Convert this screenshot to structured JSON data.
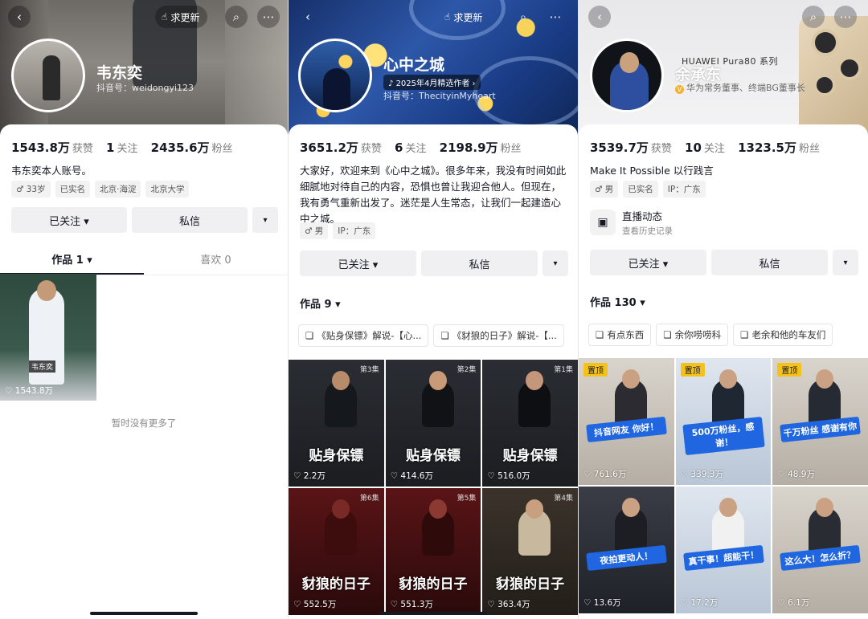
{
  "profiles": [
    {
      "update_label": "求更新",
      "name": "韦东奕",
      "douyin_id": "抖音号：weidongyi123",
      "stats": {
        "likes": "1543.8万",
        "likes_label": "获赞",
        "following": "1",
        "following_label": "关注",
        "fans": "2435.6万",
        "fans_label": "粉丝"
      },
      "bio": "韦东奕本人账号。",
      "tags": [
        "♂ 33岁",
        "已实名",
        "北京·海淀",
        "北京大学"
      ],
      "actions": {
        "follow": "已关注 ▾",
        "message": "私信",
        "more": "▾"
      },
      "tabs": [
        {
          "label": "作品 1 ▾"
        },
        {
          "label": "喜欢 0"
        }
      ],
      "works": [
        {
          "likes": "1543.8万",
          "label": "韦东奕"
        }
      ],
      "no_more": "暂时没有更多了"
    },
    {
      "update_label": "求更新",
      "name": "心中之城",
      "badge": "2025年4月精选作者 ›",
      "douyin_id": "抖音号：ThecityinMyheart",
      "stats": {
        "likes": "3651.2万",
        "likes_label": "获赞",
        "following": "6",
        "following_label": "关注",
        "fans": "2198.9万",
        "fans_label": "粉丝"
      },
      "bio": "大家好，欢迎来到《心中之城》。很多年来，我没有时间如此细腻地对待自己的内容，恐惧也曾让我迎合他人。但现在，我有勇气重新出发了。迷茫是人生常态，让我们一起建造心中之城。",
      "tags": [
        "♂ 男",
        "IP：广东"
      ],
      "actions": {
        "follow": "已关注 ▾",
        "message": "私信",
        "more": "▾"
      },
      "works_label": "作品 9 ▾",
      "chips": [
        "《贴身保镖》解说-【心...",
        "《豺狼的日子》解说-【..."
      ],
      "works": [
        {
          "caption": "贴身保镖",
          "ep": "第3集",
          "likes": "2.2万"
        },
        {
          "caption": "贴身保镖",
          "ep": "第2集",
          "likes": "414.6万"
        },
        {
          "caption": "贴身保镖",
          "ep": "第1集",
          "likes": "516.0万"
        },
        {
          "caption": "豺狼的日子",
          "ep": "第6集",
          "likes": "552.5万"
        },
        {
          "caption": "豺狼的日子",
          "ep": "第5集",
          "likes": "551.3万"
        },
        {
          "caption": "豺狼的日子",
          "ep": "第4集",
          "likes": "363.4万"
        }
      ]
    },
    {
      "name": "余承东",
      "brand": "HUAWEI Pura80 系列",
      "verify": "华为常务董事、终端BG董事长",
      "stats": {
        "likes": "3539.7万",
        "likes_label": "获赞",
        "following": "10",
        "following_label": "关注",
        "fans": "1323.5万",
        "fans_label": "粉丝"
      },
      "bio": "Make It Possible 以行践言",
      "tags": [
        "♂ 男",
        "已实名",
        "IP：广东"
      ],
      "live": {
        "title": "直播动态",
        "sub": "查看历史记录"
      },
      "actions": {
        "follow": "已关注 ▾",
        "message": "私信",
        "more": "▾"
      },
      "works_label": "作品 130 ▾",
      "chips": [
        "有点东西",
        "余你唠唠科",
        "老余和他的车友们"
      ],
      "pin_label": "置顶",
      "works": [
        {
          "banner": "抖音网友 你好！",
          "likes": "761.6万"
        },
        {
          "banner": "500万粉丝，感谢！",
          "likes": "339.3万"
        },
        {
          "banner": "千万粉丝 感谢有你",
          "likes": "48.9万"
        },
        {
          "banner": "夜拍更动人！",
          "likes": "13.6万"
        },
        {
          "banner": "真干事！超能干！",
          "likes": "17.2万"
        },
        {
          "banner": "这么大！怎么折？",
          "likes": "6.1万"
        }
      ]
    }
  ]
}
